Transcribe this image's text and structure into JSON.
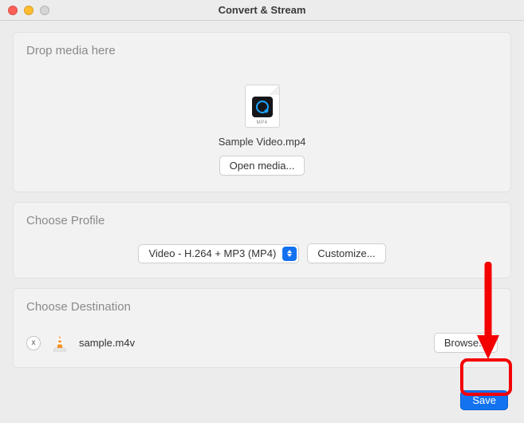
{
  "window": {
    "title": "Convert & Stream"
  },
  "drop": {
    "heading": "Drop media here",
    "thumb_type": "MP4",
    "filename": "Sample Video.mp4",
    "open_label": "Open media..."
  },
  "profile": {
    "heading": "Choose Profile",
    "selected": "Video - H.264 + MP3 (MP4)",
    "customize_label": "Customize..."
  },
  "destination": {
    "heading": "Choose Destination",
    "filename": "sample.m4v",
    "browse_label": "Browse...",
    "close_glyph": "x"
  },
  "footer": {
    "save_label": "Save"
  },
  "colors": {
    "accent": "#1372ef",
    "annotation": "#f40001"
  }
}
